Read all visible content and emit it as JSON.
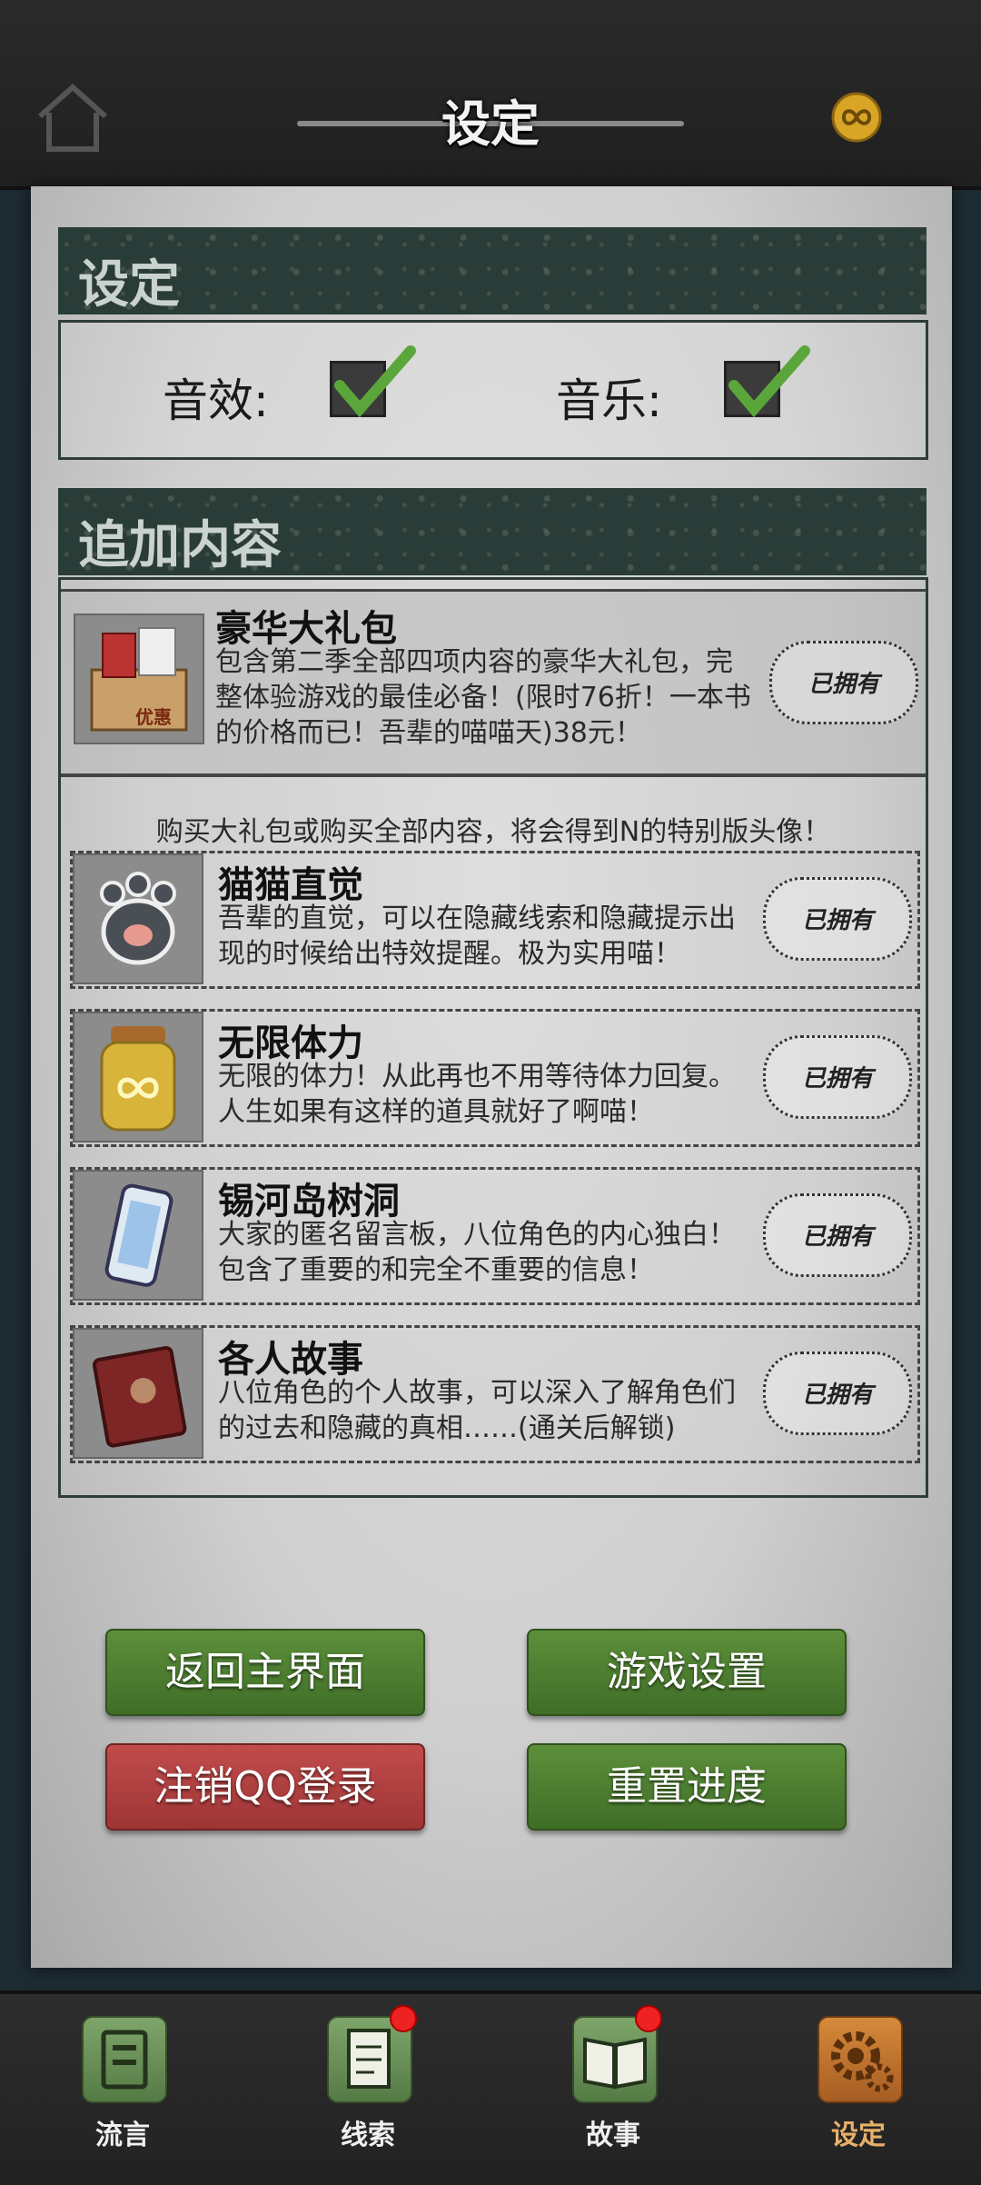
{
  "header": {
    "title": "设定",
    "home_icon": "home-icon",
    "coin_icon": "infinity-coin-icon"
  },
  "settings": {
    "title": "设定",
    "sound_effects_label": "音效:",
    "sound_effects_on": true,
    "music_label": "音乐:",
    "music_on": true
  },
  "addons": {
    "title": "追加内容",
    "bundle": {
      "title": "豪华大礼包",
      "description": "包含第二季全部四项内容的豪华大礼包，完整体验游戏的最佳必备！(限时76折！一本书的价格而已！吾辈的喵喵天)38元！",
      "thumb_label": "优惠",
      "owned_label": "已拥有"
    },
    "promo_text": "购买大礼包或购买全部内容，将会得到N的特别版头像！",
    "items": [
      {
        "title": "猫猫直觉",
        "description": "吾辈的直觉，可以在隐藏线索和隐藏提示出现的时候给出特效提醒。极为实用喵！",
        "owned_label": "已拥有",
        "icon": "cat-paw-icon"
      },
      {
        "title": "无限体力",
        "description": "无限的体力！从此再也不用等待体力回复。人生如果有这样的道具就好了啊喵！",
        "owned_label": "已拥有",
        "icon": "infinity-jar-icon"
      },
      {
        "title": "锡河岛树洞",
        "description": "大家的匿名留言板，八位角色的内心独白！包含了重要的和完全不重要的信息！",
        "owned_label": "已拥有",
        "icon": "phone-icon"
      },
      {
        "title": "各人故事",
        "description": "八位角色的个人故事，可以深入了解角色们的过去和隐藏的真相……(通关后解锁)",
        "owned_label": "已拥有",
        "icon": "book-icon"
      }
    ]
  },
  "buttons": {
    "return_main": "返回主界面",
    "game_settings": "游戏设置",
    "logout_qq": "注销QQ登录",
    "reset_progress": "重置进度"
  },
  "nav": {
    "items": [
      {
        "label": "流言",
        "icon": "rumor-icon",
        "badge": false,
        "active": false
      },
      {
        "label": "线索",
        "icon": "clue-notepad-icon",
        "badge": true,
        "active": false
      },
      {
        "label": "故事",
        "icon": "story-book-icon",
        "badge": true,
        "active": false
      },
      {
        "label": "设定",
        "icon": "settings-gear-icon",
        "badge": false,
        "active": true
      }
    ]
  },
  "colors": {
    "accent_green": "#4f7f31",
    "danger_red": "#b04141",
    "header_dark": "#2a3c37",
    "active_nav": "#d58a3b"
  }
}
